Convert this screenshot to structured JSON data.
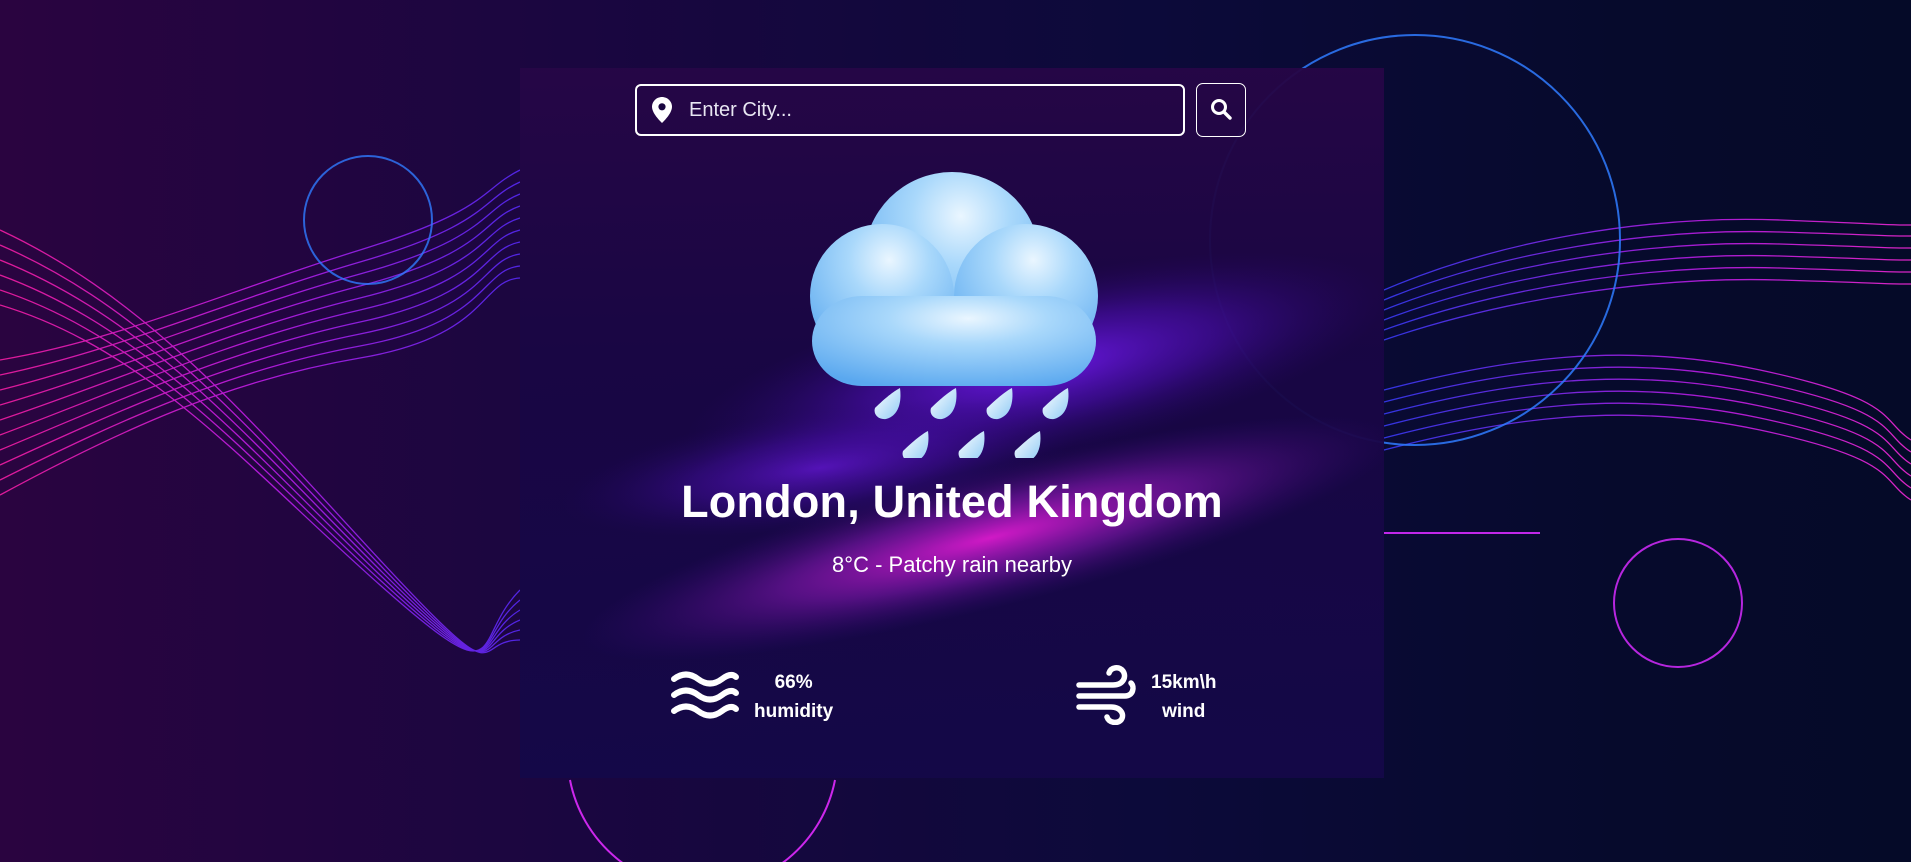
{
  "search": {
    "placeholder": "Enter City...",
    "value": ""
  },
  "icons": {
    "location": "map-pin-icon",
    "search": "magnifier-icon",
    "weather": "rain-cloud-icon",
    "humidity": "water-waves-icon",
    "wind": "wind-icon"
  },
  "weather": {
    "location": "London, United Kingdom",
    "summary": "8°C - Patchy rain nearby"
  },
  "stats": {
    "humidity": {
      "value": "66%",
      "label": "humidity"
    },
    "wind": {
      "value": "15km\\h",
      "label": "wind"
    }
  },
  "colors": {
    "text": "#ffffff",
    "accent_magenta": "#ff1ee6",
    "accent_blue": "#2f7bff",
    "background": "#0b0730"
  }
}
